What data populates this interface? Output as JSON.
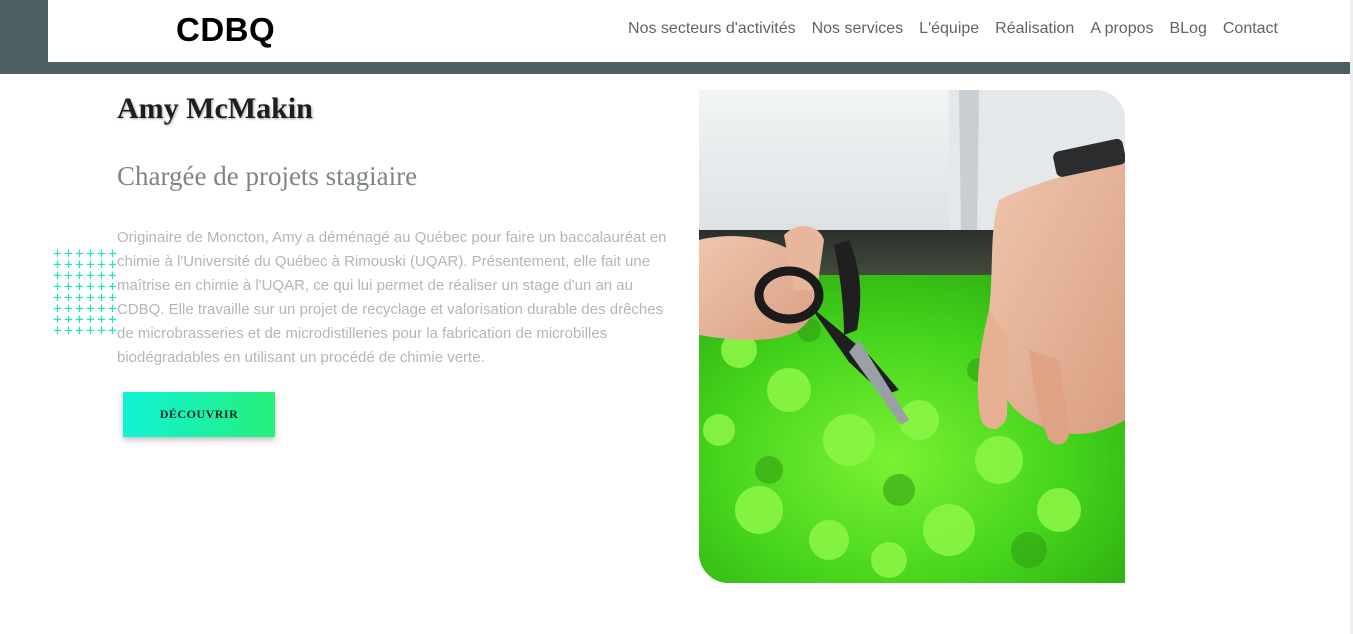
{
  "site": {
    "logo": "CDBQ"
  },
  "nav": {
    "items": [
      {
        "label": "Nos secteurs d'activités"
      },
      {
        "label": "Nos services"
      },
      {
        "label": "L'équipe"
      },
      {
        "label": "Réalisation"
      },
      {
        "label": "A propos"
      },
      {
        "label": "BLog"
      },
      {
        "label": "Contact"
      }
    ]
  },
  "profile": {
    "name": "Amy McMakin",
    "role": "Chargée de projets stagiaire",
    "bio": "Originaire de Moncton, Amy a déménagé au Québec pour faire un baccalauréat en chimie à l'Université du Québec à Rimouski (UQAR). Présentement, elle fait une maîtrise en chimie à l'UQAR, ce qui lui permet de réaliser un stage d'un an au CDBQ. Elle travaille sur un projet de recyclage et valorisation durable des drêches de microbrasseries et de microdistilleries pour la fabrication de microbilles biodégradables en utilisant un procédé de chimie verte.",
    "cta_label": "DÉCOUVRIR"
  },
  "decor": {
    "pattern_icon": "plus-grid-pattern",
    "photo_icon": "hands-cutting-microgreens-photo"
  },
  "colors": {
    "header_strip": "#4d5e63",
    "accent_start": "#0ff2d6",
    "accent_end": "#27f07a",
    "plus_pattern": "#19e3c3"
  }
}
